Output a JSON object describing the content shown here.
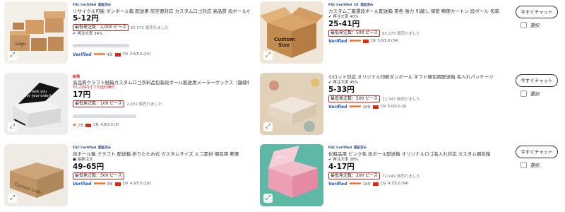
{
  "products": [
    {
      "badges": [
        "FSC Certified",
        "認証済み"
      ],
      "new_label": "",
      "title": "リサイクル可能 ダンボール箱 配送用 航空便対応 カスタムロゴ対応 高品質 段ボールボックス",
      "subtitle": "",
      "price": "5-12円",
      "moq": "最低発注数：2,000 ピース",
      "sold": "60,575 個売れました",
      "rate": "再注文率 34%",
      "verified": "Verified",
      "years": "4年",
      "country": "CN",
      "score": "4.6/5.0 (10)",
      "image_labels": [
        "Logo"
      ],
      "show_chat": false
    },
    {
      "badges": [
        "FSC Certified",
        "CE",
        "認証済み"
      ],
      "new_label": "",
      "title": "カスタムご厳選段ボール配送箱 茶色 強力 引越し 保管 郵便カートン 段ボール 包装",
      "subtitle": "",
      "price": "25-41円",
      "moq": "最低発注数：500 ピース",
      "sold": "83,273 個売れました",
      "rate": "再注文率 40%",
      "verified": "Verified",
      "years": "",
      "country": "CN",
      "score": "5.0/5.0 (34)",
      "image_labels": [
        "Custom",
        "Size"
      ],
      "show_chat": true
    },
    {
      "badges": [],
      "new_label": "新規",
      "title": "高品質クラフト紙箱カスタムロゴ衣料品包装段ボール配送用メーラーボックス（額縁付き）",
      "subtitle": "¥3,229円オフの送料無料",
      "price": "17円",
      "moq": "最低発注数：100 ピース",
      "sold": "2,001 個売れました",
      "rate": "",
      "verified": "",
      "years": "2年",
      "country": "CN",
      "score": "4.9/5.0 (5)",
      "image_labels": [
        "Thank you",
        "for your order!"
      ],
      "show_chat": false
    },
    {
      "badges": [],
      "new_label": "",
      "title": "小ロット対応 オリジナル印刷ダンボール ギフト梱包用配送箱 名入れパッケージ",
      "subtitle": "",
      "price": "5-33円",
      "moq": "最低発注数：500 ピース",
      "sold": "72,347 個売れました",
      "rate": "再注文率 45%",
      "verified": "Verified",
      "years": "10年",
      "country": "CN",
      "score": "5.0/5.0 (9)",
      "image_labels": [],
      "show_chat": true
    },
    {
      "badges": [
        "FSC Certified",
        "認証済み"
      ],
      "new_label": "",
      "title": "段ボール箱 クラフト 配送箱 折りたたみ式 カスタムサイズ エコ素材 梱包用 郵便",
      "subtitle": "",
      "price": "49-65円",
      "moq": "最低発注数：500 ピース",
      "sold": "",
      "rate": "最新注文",
      "verified": "Verified",
      "years": "3年",
      "country": "CN",
      "score": "4.9/5.0 (19)",
      "image_labels": [
        "Custom Logo"
      ],
      "show_chat": false
    },
    {
      "badges": [
        "FSC Certified",
        "認証済み"
      ],
      "new_label": "",
      "title": "化粧品用 ピンク色 段ボール配送箱 オリジナルロゴ名入れ対応 カスタム梱包箱",
      "subtitle": "",
      "price": "4-17円",
      "moq": "最低発注数：200 ピース",
      "sold": "72,949 個売れました",
      "rate": "再注文率 28%",
      "verified": "Verified",
      "years": "10年",
      "country": "CN",
      "score": "4.7/5.0 (54)",
      "image_labels": [],
      "show_chat": true
    }
  ],
  "actions": {
    "chat_label": "今すぐチャット",
    "select_label": "選択"
  },
  "colors": {
    "highlight_border": "#d9231b",
    "verified": "#1f57b8",
    "stars": "#f36b1c",
    "discount": "#e0201b"
  },
  "icons": {
    "expand": "expand-icon",
    "check": "check-icon",
    "flag": "china-flag-icon",
    "star": "star-icon"
  }
}
